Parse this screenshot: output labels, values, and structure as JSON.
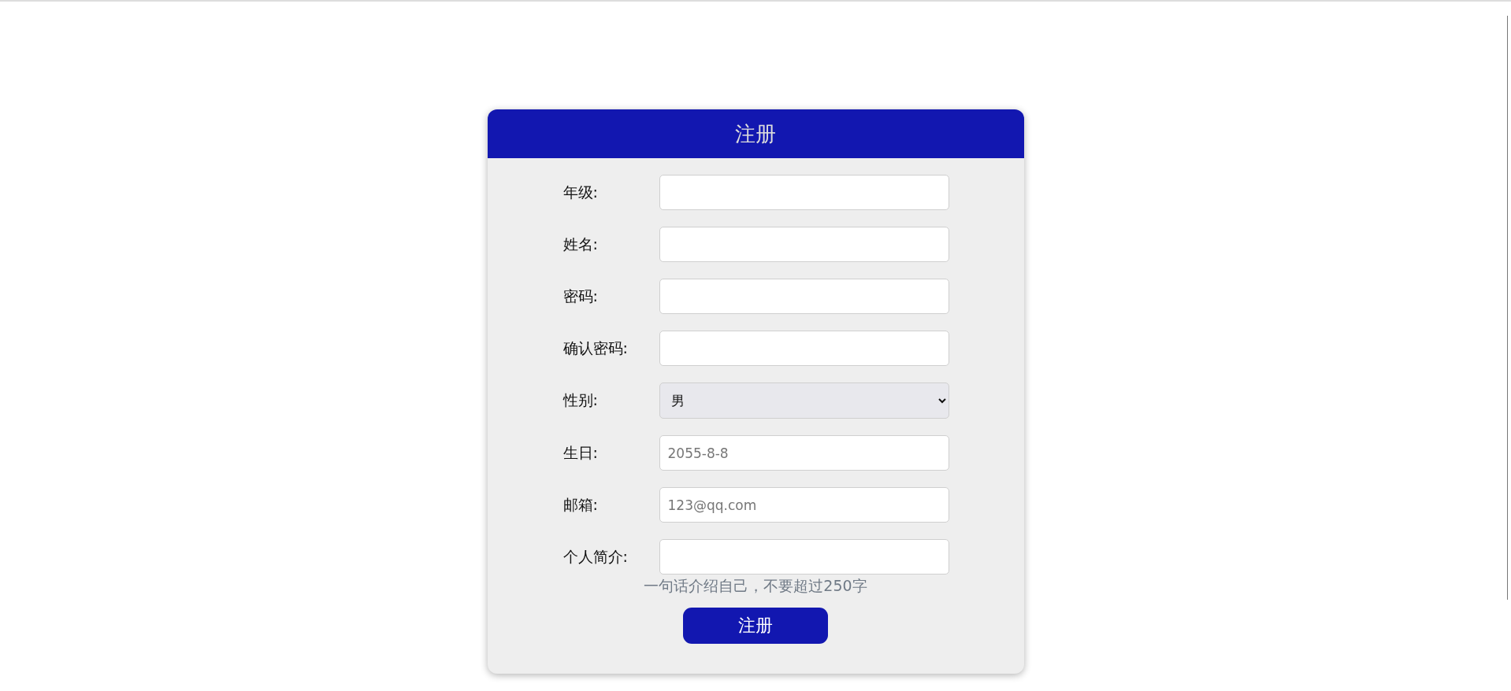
{
  "header": {
    "title": "注册"
  },
  "fields": [
    {
      "label": "年级:",
      "kind": "text"
    },
    {
      "label": "姓名:",
      "kind": "text"
    },
    {
      "label": "密码:",
      "kind": "text"
    },
    {
      "label": "确认密码:",
      "kind": "text"
    },
    {
      "label": "性别:",
      "kind": "select",
      "value": "男"
    },
    {
      "label": "生日:",
      "kind": "text",
      "placeholder": "2055-8-8"
    },
    {
      "label": "邮箱:",
      "kind": "text",
      "placeholder": "123@qq.com"
    },
    {
      "label": "个人简介:",
      "kind": "text"
    }
  ],
  "hint": "一句话介绍自己，不要超过250字",
  "submit": "注册"
}
